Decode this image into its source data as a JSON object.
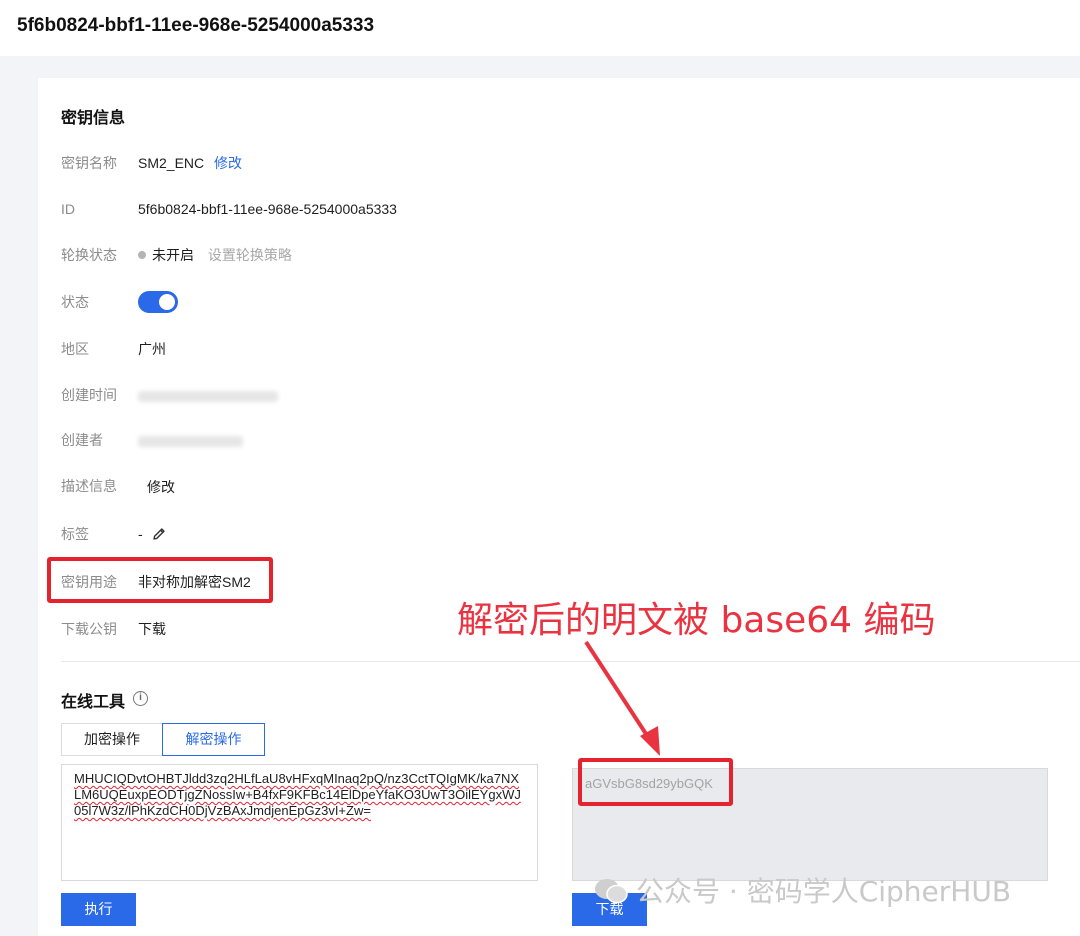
{
  "page_title": "5f6b0824-bbf1-11ee-968e-5254000a5333",
  "section_title": "密钥信息",
  "fields": {
    "key_name_label": "密钥名称",
    "key_name_value": "SM2_ENC",
    "key_name_edit": "修改",
    "id_label": "ID",
    "id_value": "5f6b0824-bbf1-11ee-968e-5254000a5333",
    "rotation_label": "轮换状态",
    "rotation_value": "未开启",
    "rotation_link": "设置轮换策略",
    "status_label": "状态",
    "status_enabled": true,
    "region_label": "地区",
    "region_value": "广州",
    "created_time_label": "创建时间",
    "creator_label": "创建者",
    "description_label": "描述信息",
    "description_edit": "修改",
    "tags_label": "标签",
    "tags_value": "-",
    "usage_label": "密钥用途",
    "usage_value": "非对称加解密SM2",
    "download_pubkey_label": "下载公钥",
    "download_pubkey_link": "下载"
  },
  "tools": {
    "title": "在线工具",
    "tabs": [
      {
        "label": "加密操作",
        "active": false
      },
      {
        "label": "解密操作",
        "active": true
      }
    ],
    "ciphertext": "MHUCIQDvtOHBTJldd3zq2HLfLaU8vHFxqMInaq2pQ/nz3CctTQIgMK/ka7NXLM6UQEuxpEODTjgZNossIw+B4fxF9KFBc14ElDpeYfaKO3UwT3OilEYgxWJ05l7W3z/lPhKzdCH0DjVzBAxJmdjenEpGz3vI+Zw=",
    "plaintext": "aGVsbG8sd29ybGQK",
    "execute_button": "执行",
    "download_button": "下载"
  },
  "annotation": {
    "text": "解密后的明文被 base64 编码",
    "color": "#ea3340"
  },
  "watermark": "公众号 · 密码学人CipherHUB",
  "colors": {
    "accent": "#2a6ae8",
    "highlight": "#e5232f"
  }
}
